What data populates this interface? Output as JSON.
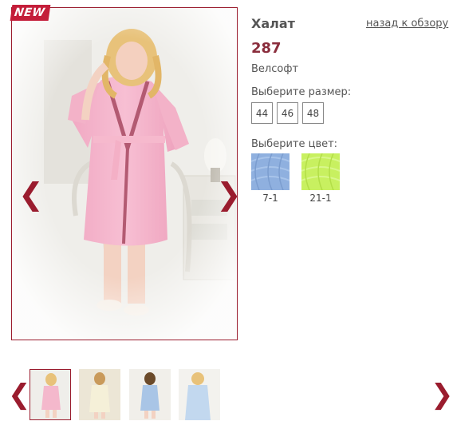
{
  "badge": "NEW",
  "product": {
    "title": "Халат",
    "price": "287",
    "material": "Велсофт",
    "back_link": "назад к обзору"
  },
  "sizes": {
    "label": "Выберите размер:",
    "options": [
      "44",
      "46",
      "48"
    ]
  },
  "colors": {
    "label": "Выберите цвет:",
    "options": [
      {
        "code": "7-1",
        "hex": "#8fb0df"
      },
      {
        "code": "21-1",
        "hex": "#c8f060"
      }
    ]
  },
  "gallery": {
    "prev_icon": "chevron-left-icon",
    "next_icon": "chevron-right-icon",
    "thumbnails": [
      {
        "robe_color": "#f4b8cc",
        "active": true
      },
      {
        "robe_color": "#f5f0d8",
        "active": false
      },
      {
        "robe_color": "#a9c5e6",
        "active": false
      },
      {
        "robe_color": "#c2d8ef",
        "active": false
      }
    ]
  },
  "accent_color": "#9a1c2e"
}
